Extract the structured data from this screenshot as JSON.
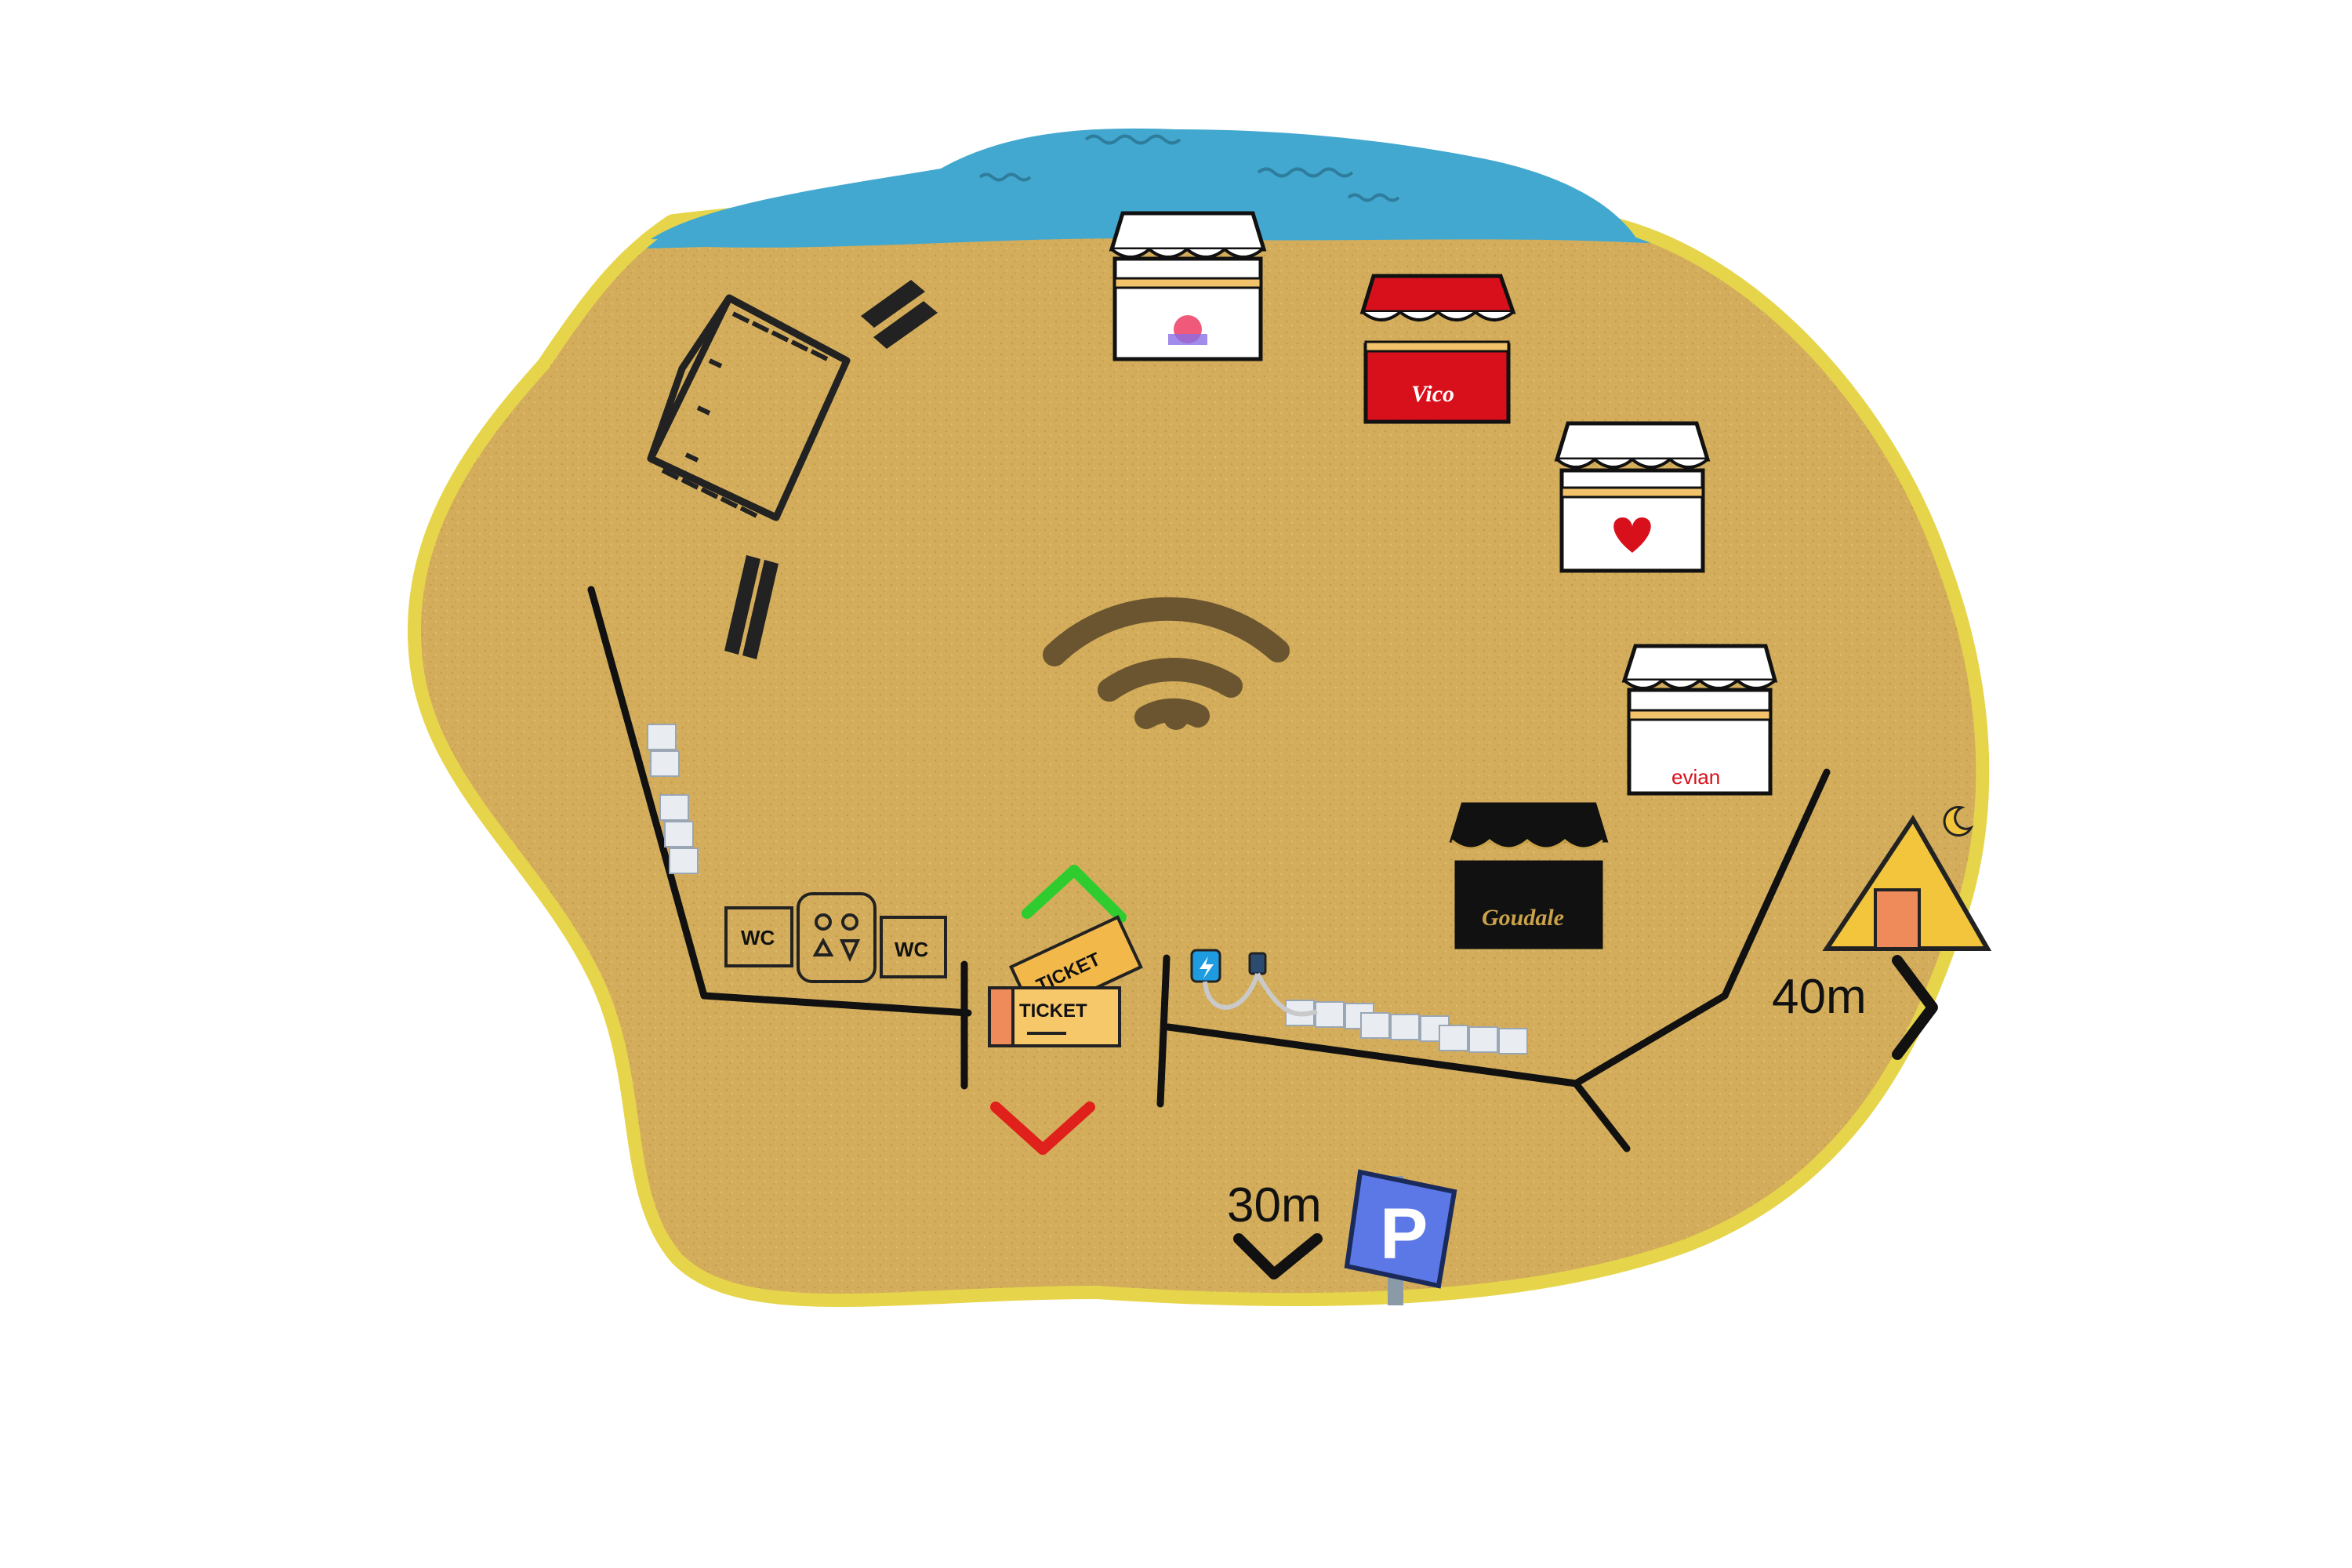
{
  "map": {
    "colors": {
      "sea": "#43a8cf",
      "sand": "#d4ae5c",
      "shore": "#e8d84a",
      "path": "#111111",
      "entry_arrow": "#2ecc2e",
      "exit_arrow": "#e0201a",
      "parking_sign": "#5b78e6",
      "tent": "#f2c53d"
    },
    "toilets": {
      "left_label": "WC",
      "right_label": "WC"
    },
    "ticket": {
      "label": "TICKET",
      "label_back": "TICKET"
    },
    "parking": {
      "distance": "30m",
      "sign_letter": "P"
    },
    "camping": {
      "distance": "40m"
    },
    "stands": [
      {
        "brand": "",
        "color": "#ffffff",
        "icon": "sunset-logo"
      },
      {
        "brand": "Vico",
        "color": "#d8101c",
        "icon": "vico-logo"
      },
      {
        "brand": "",
        "color": "#ffffff",
        "icon": "heart-logo"
      },
      {
        "brand": "evian",
        "color": "#ffffff",
        "icon": "evian-logo"
      },
      {
        "brand": "Goudale",
        "color": "#111111",
        "icon": "goudale-logo"
      }
    ],
    "icons": [
      "stage-icon",
      "wifi-icon",
      "charging-icon",
      "parking-sign-icon",
      "tent-icon",
      "ticket-icon",
      "toilet-icon"
    ]
  }
}
